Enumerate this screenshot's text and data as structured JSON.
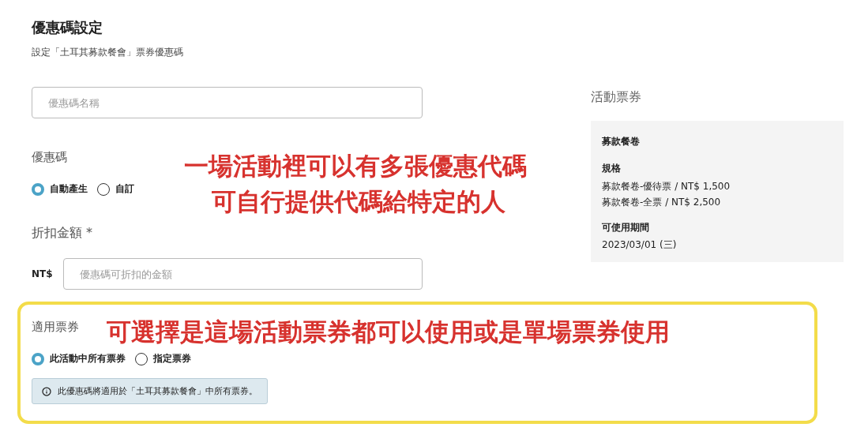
{
  "page": {
    "title": "優惠碼設定",
    "subtitle": "設定「土耳其募款餐會」票券優惠碼"
  },
  "form": {
    "name_field": {
      "placeholder": "優惠碼名稱"
    },
    "code": {
      "label": "優惠碼",
      "options": [
        {
          "label": "自動產生",
          "selected": true
        },
        {
          "label": "自訂",
          "selected": false
        }
      ]
    },
    "amount": {
      "label": "折扣金額 *",
      "currency": "NT$",
      "placeholder": "優惠碼可折扣的金額"
    },
    "tickets": {
      "label": "適用票券",
      "options": [
        {
          "label": "此活動中所有票券",
          "selected": true
        },
        {
          "label": "指定票券",
          "selected": false
        }
      ],
      "info": "此優惠碼將適用於「土耳其募款餐會」中所有票券。"
    }
  },
  "sidebar": {
    "heading": "活動票券",
    "card": {
      "title": "募款餐卷",
      "spec_label": "規格",
      "specs": [
        "募款餐卷-優待票 / NT$ 1,500",
        "募款餐卷-全票 / NT$ 2,500"
      ],
      "period_label": "可使用期間",
      "period": "2023/03/01 (三)"
    }
  },
  "annotations": [
    {
      "lines": [
        "一場活動裡可以有多張優惠代碼",
        "可自行提供代碼給特定的人"
      ]
    },
    {
      "lines": [
        "可選擇是這場活動票券都可以使用或是單場票券使用"
      ]
    }
  ]
}
